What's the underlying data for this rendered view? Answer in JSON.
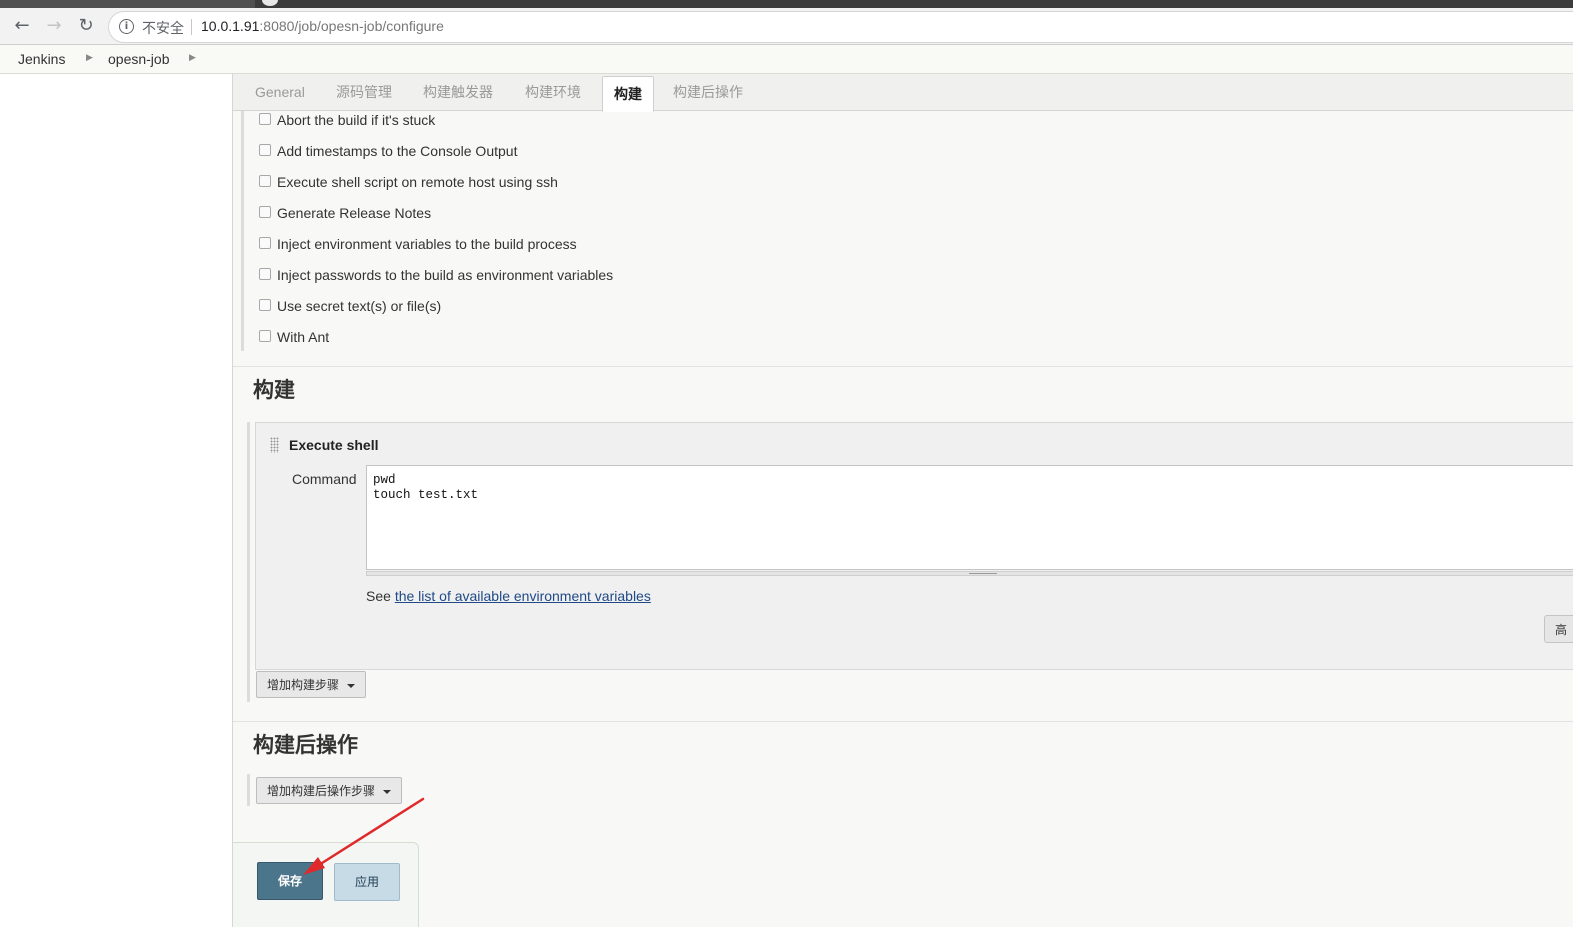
{
  "browser": {
    "security_label": "不安全",
    "url_host": "10.0.1.91",
    "url_rest": ":8080/job/opesn-job/configure",
    "nav_icons": [
      "back-arrow-icon",
      "forward-arrow-icon",
      "reload-icon"
    ]
  },
  "breadcrumb": {
    "items": [
      {
        "label": "Jenkins"
      },
      {
        "label": "opesn-job"
      }
    ]
  },
  "tabs": [
    {
      "label": "General",
      "active": false
    },
    {
      "label": "源码管理",
      "active": false
    },
    {
      "label": "构建触发器",
      "active": false
    },
    {
      "label": "构建环境",
      "active": false
    },
    {
      "label": "构建",
      "active": true
    },
    {
      "label": "构建后操作",
      "active": false
    }
  ],
  "build_environment": {
    "options": [
      {
        "label": "Abort the build if it's stuck",
        "checked": false
      },
      {
        "label": "Add timestamps to the Console Output",
        "checked": false
      },
      {
        "label": "Execute shell script on remote host using ssh",
        "checked": false
      },
      {
        "label": "Generate Release Notes",
        "checked": false
      },
      {
        "label": "Inject environment variables to the build process",
        "checked": false
      },
      {
        "label": "Inject passwords to the build as environment variables",
        "checked": false
      },
      {
        "label": "Use secret text(s) or file(s)",
        "checked": false
      },
      {
        "label": "With Ant",
        "checked": false
      }
    ]
  },
  "build": {
    "title": "构建",
    "step": {
      "title": "Execute shell",
      "command_label": "Command",
      "command_value": "pwd\ntouch test.txt",
      "see_prefix": "See ",
      "see_link": "the list of available environment variables",
      "advanced_label": "高"
    },
    "add_step_label": "增加构建步骤"
  },
  "post_build": {
    "title": "构建后操作",
    "add_step_label": "增加构建后操作步骤"
  },
  "footer": {
    "save_label": "保存",
    "apply_label": "应用"
  },
  "colors": {
    "annotation_arrow": "#e0292b",
    "save_button": "#4b758b",
    "apply_button": "#c7dbe7"
  }
}
